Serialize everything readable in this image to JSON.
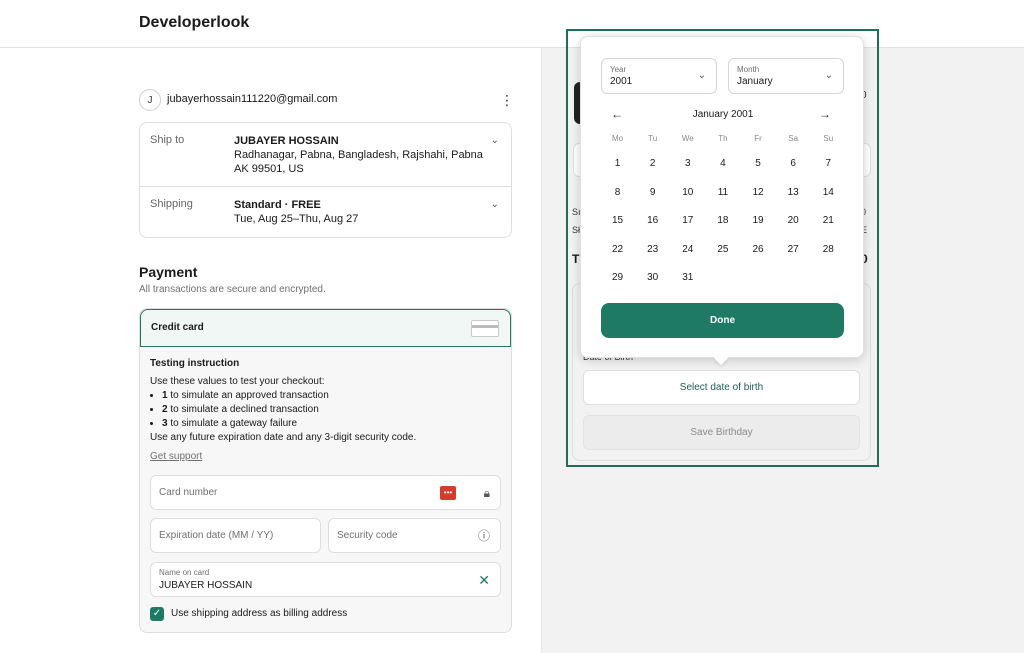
{
  "header": {
    "brand": "Developerlook"
  },
  "account": {
    "avatar_initial": "J",
    "email": "jubayerhossain111220@gmail.com",
    "menu_icon": "kebab-icon"
  },
  "summary": {
    "ship_to": {
      "label": "Ship to",
      "name": "JUBAYER HOSSAIN",
      "address": "Radhanagar, Pabna, Bangladesh, Rajshahi, Pabna AK 99501, US"
    },
    "shipping": {
      "label": "Shipping",
      "method": "Standard · FREE",
      "dates": "Tue, Aug 25–Thu, Aug 27"
    }
  },
  "payment": {
    "title": "Payment",
    "subtitle": "All transactions are secure and encrypted.",
    "method": "Credit card",
    "instructions": {
      "heading": "Testing instruction",
      "intro": "Use these values to test your checkout:",
      "items": [
        {
          "num": "1",
          "text": " to simulate an approved transaction"
        },
        {
          "num": "2",
          "text": " to simulate a declined transaction"
        },
        {
          "num": "3",
          "text": " to simulate a gateway failure"
        }
      ],
      "outro": "Use any future expiration date and any 3-digit security code.",
      "support": "Get support"
    },
    "card_number": {
      "placeholder": "Card number"
    },
    "expiration": {
      "placeholder": "Expiration date (MM / YY)"
    },
    "security": {
      "placeholder": "Security code"
    },
    "name_on_card": {
      "label": "Name on card",
      "value": "JUBAYER HOSSAIN"
    },
    "billing_same": {
      "label": "Use shipping address as billing address",
      "checked": true
    }
  },
  "order_summary": {
    "price_fragment": "0",
    "sub_fragment_1": "Sı",
    "sub_fragment_2": "Sł",
    "val_fragment_1": "0",
    "val_fragment_2": "E",
    "total_fragment": "T",
    "total_val_fragment": "0"
  },
  "birthday": {
    "label": "Date of Birth",
    "select_button": "Select date of birth",
    "save_button": "Save Birthday"
  },
  "datepicker": {
    "year_label": "Year",
    "year_value": "2001",
    "month_label": "Month",
    "month_value": "January",
    "title": "January 2001",
    "weekdays": [
      "Mo",
      "Tu",
      "We",
      "Th",
      "Fr",
      "Sa",
      "Su"
    ],
    "weeks": [
      [
        "1",
        "2",
        "3",
        "4",
        "5",
        "6",
        "7"
      ],
      [
        "8",
        "9",
        "10",
        "11",
        "12",
        "13",
        "14"
      ],
      [
        "15",
        "16",
        "17",
        "18",
        "19",
        "20",
        "21"
      ],
      [
        "22",
        "23",
        "24",
        "25",
        "26",
        "27",
        "28"
      ],
      [
        "29",
        "30",
        "31",
        "",
        "",
        "",
        ""
      ]
    ],
    "done": "Done"
  },
  "colors": {
    "accent": "#1f7a63",
    "highlight_border": "#1f6e58"
  }
}
